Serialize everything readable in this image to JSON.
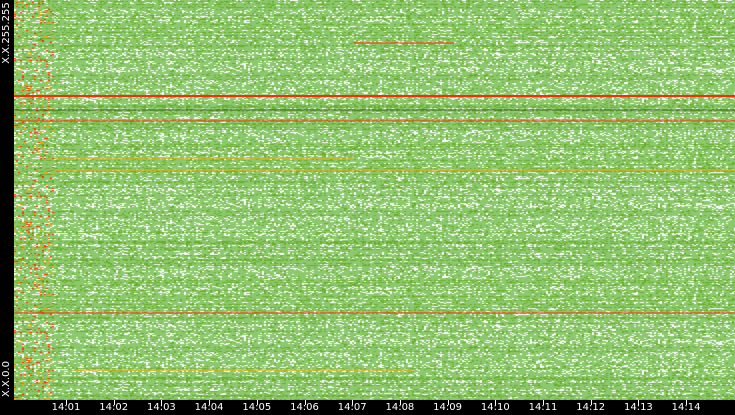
{
  "chart_data": {
    "type": "heatmap",
    "title": "",
    "xlabel": "",
    "ylabel": "",
    "x_ticks": [
      "14:01",
      "14:02",
      "14:03",
      "14:04",
      "14:05",
      "14:06",
      "14:07",
      "14:08",
      "14:09",
      "14:10",
      "14:11",
      "14:12",
      "14:13",
      "14:14"
    ],
    "y_ticks": [
      "X.X.0.0",
      "X.X.255.255"
    ],
    "colors": {
      "low": "#8cc86e",
      "mid": "#6aad2a",
      "high": "#f7a400",
      "peak": "#ff2a00",
      "empty": "#ffffff",
      "background": "#000000"
    }
  }
}
